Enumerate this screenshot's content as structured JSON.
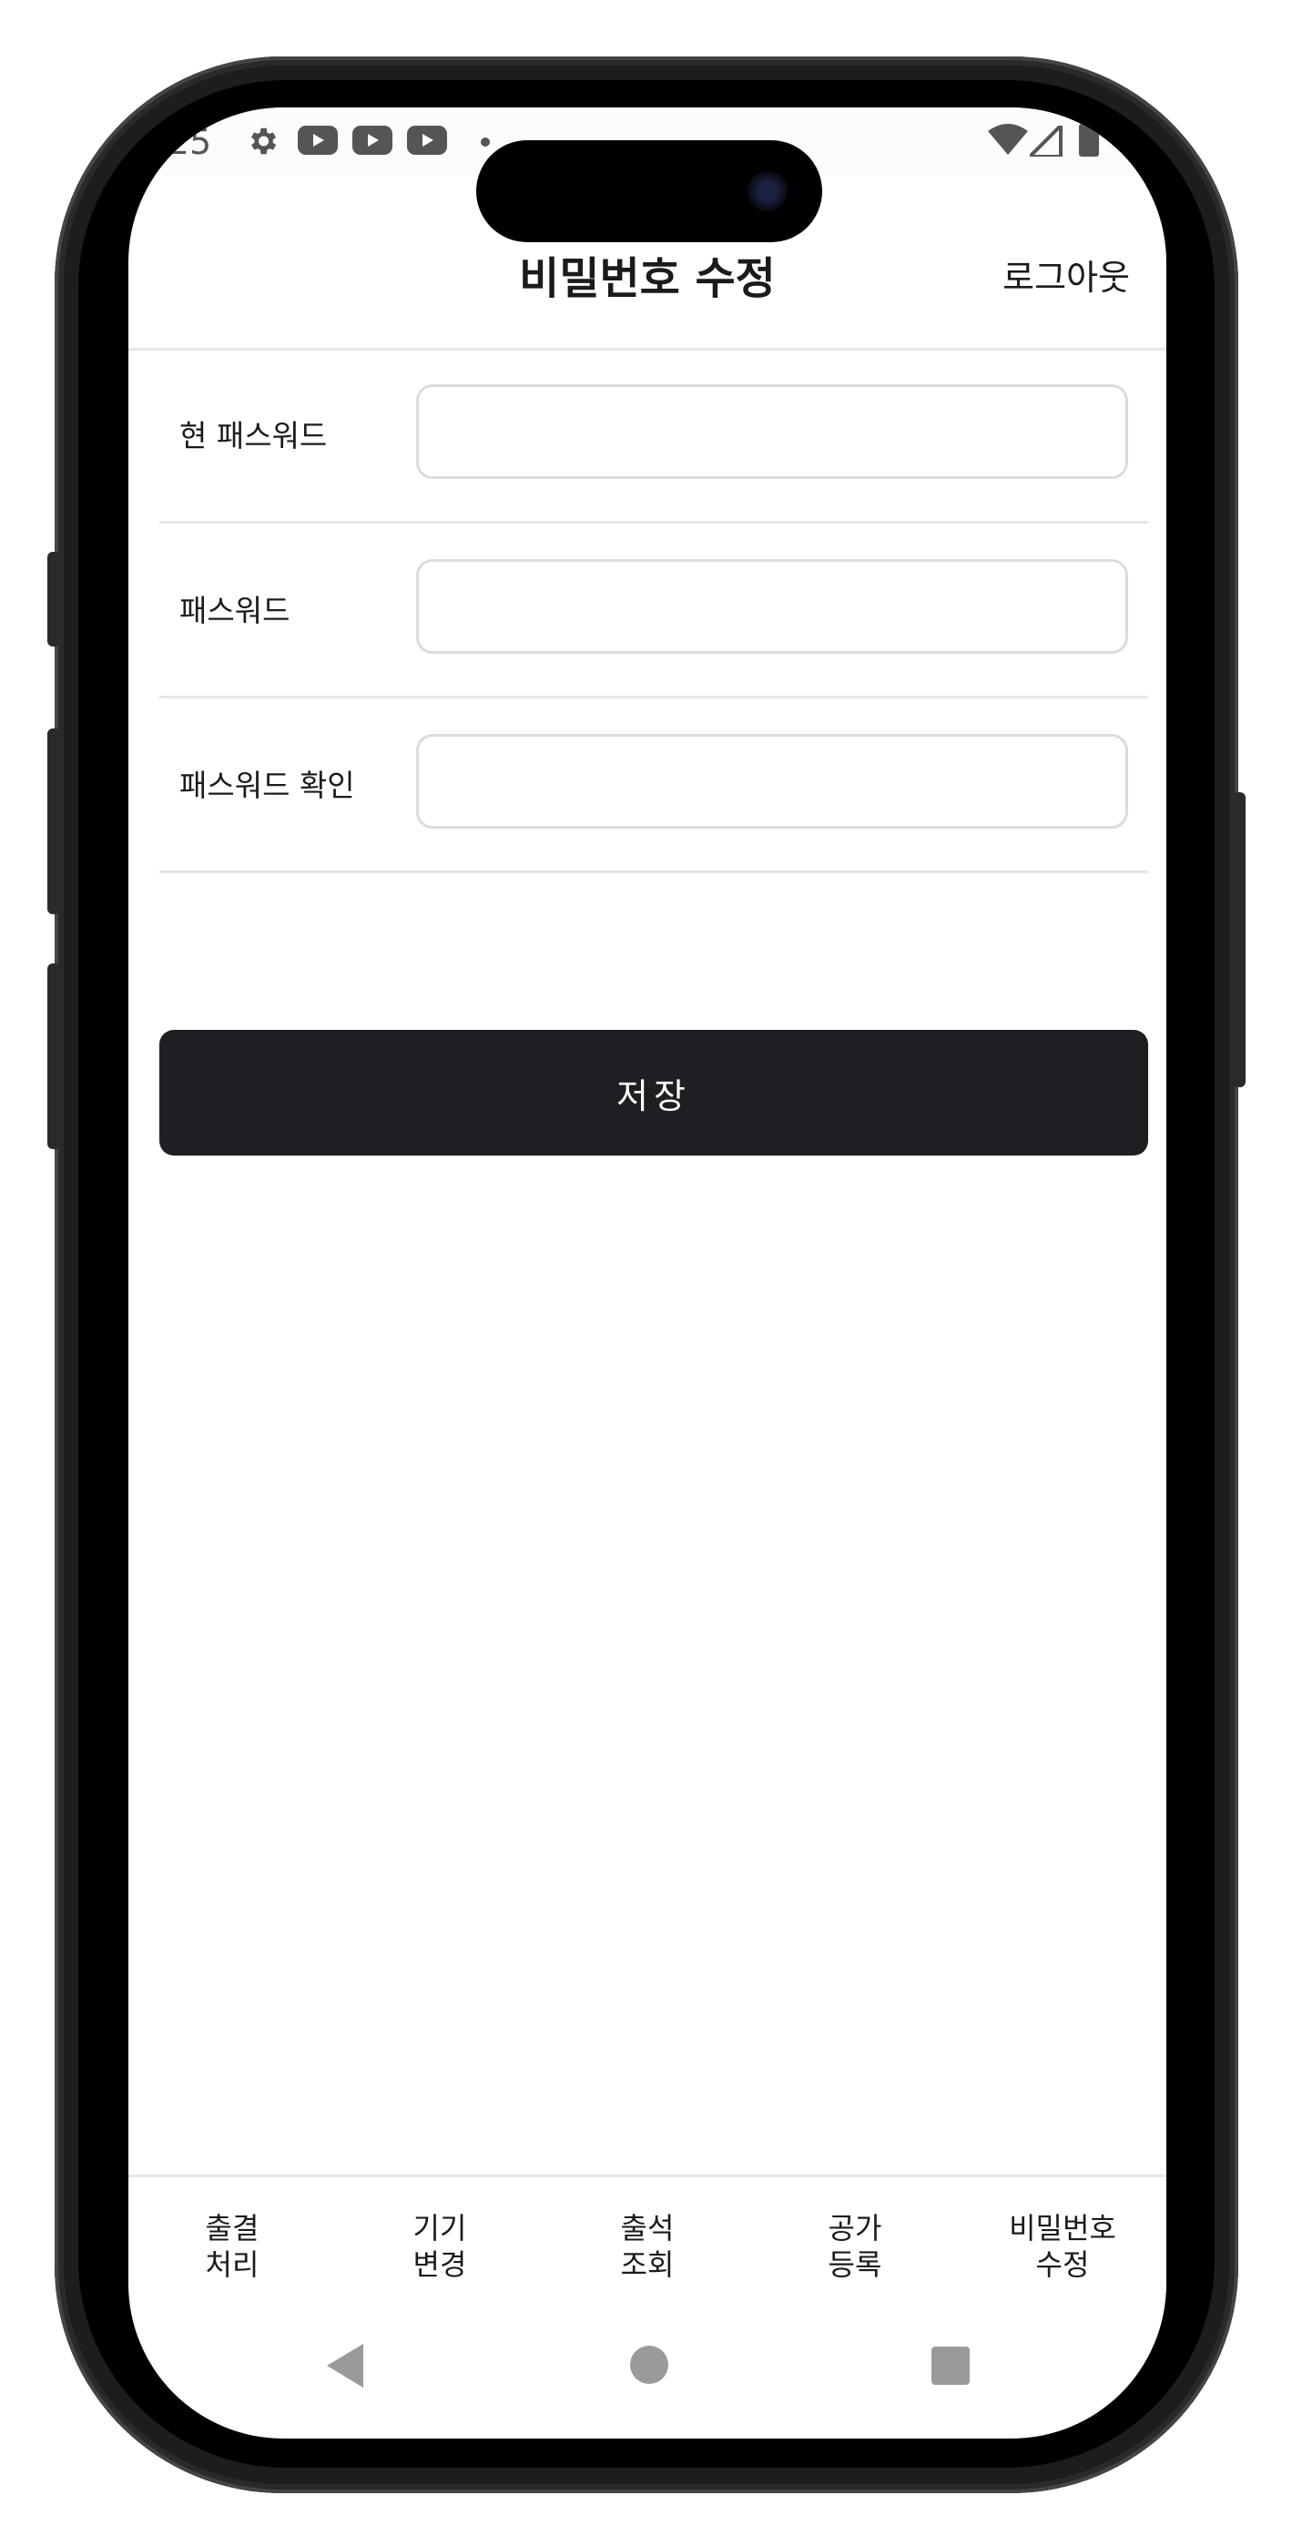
{
  "status_bar": {
    "time": ":25",
    "icons": [
      "gear-icon",
      "youtube-icon",
      "youtube-icon",
      "youtube-icon",
      "dot-icon",
      "wifi-icon",
      "signal-icon",
      "battery-icon"
    ]
  },
  "header": {
    "title": "비밀번호 수정",
    "logout_label": "로그아웃"
  },
  "form": {
    "fields": [
      {
        "label": "현 패스워드",
        "value": "",
        "placeholder": ""
      },
      {
        "label": "패스워드",
        "value": "",
        "placeholder": ""
      },
      {
        "label": "패스워드 확인",
        "value": "",
        "placeholder": ""
      }
    ],
    "save_label": "저장"
  },
  "bottom_nav": {
    "items": [
      {
        "line1": "출결",
        "line2": "처리"
      },
      {
        "line1": "기기",
        "line2": "변경"
      },
      {
        "line1": "출석",
        "line2": "조회"
      },
      {
        "line1": "공가",
        "line2": "등록"
      },
      {
        "line1": "비밀번호",
        "line2": "수정"
      }
    ]
  },
  "system_nav": {
    "icons": [
      "back-icon",
      "home-icon",
      "recents-icon"
    ]
  },
  "colors": {
    "primary_button": "#1e1f22",
    "divider": "#e6e6e6",
    "status_bar_bg": "#fdfbfe",
    "system_nav_icon": "#9a9a9a"
  }
}
